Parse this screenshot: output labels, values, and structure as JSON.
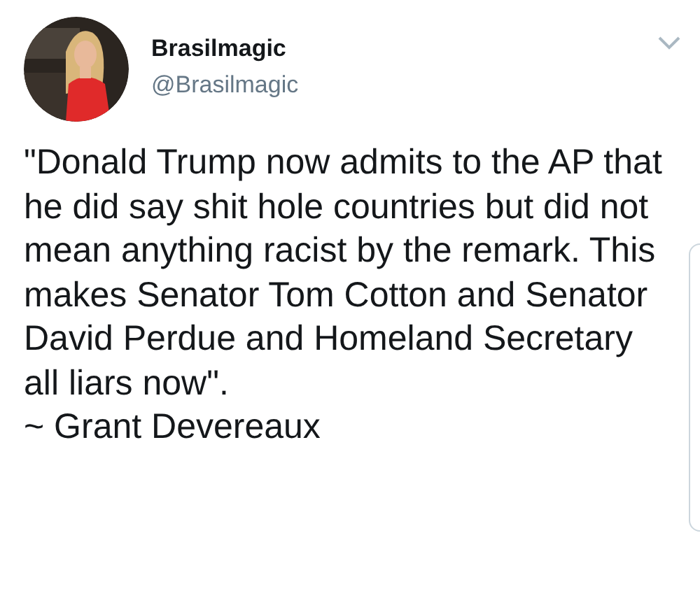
{
  "tweet": {
    "name": "Brasilmagic",
    "handle": "@Brasilmagic",
    "text": "\"Donald Trump now admits to the AP that he did say shit hole countries but did not mean anything racist by the remark. This makes Senator Tom Cotton and Senator David Perdue and Homeland Secretary all liars now\".\n~ Grant Devereaux"
  }
}
